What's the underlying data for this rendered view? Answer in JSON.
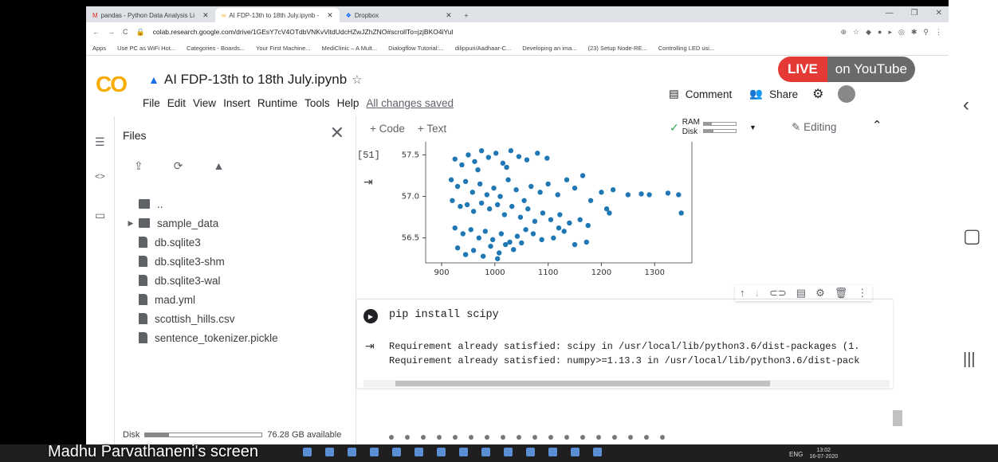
{
  "browser": {
    "tabs": [
      {
        "label": "pandas - Python Data Analysis Li"
      },
      {
        "label": "AI FDP-13th to 18th July.ipynb -"
      },
      {
        "label": "Dropbox"
      }
    ],
    "url": "colab.research.google.com/drive/1GEsY7cV4OTdbVNKvVitdUdcHZwJZhZNO#scrollTo=jzjBKO4iYul",
    "bookmarks": [
      "Apps",
      "Use PC as WiFi Hot...",
      "Categories - Boards...",
      "Your First Machine...",
      "MediClinic – A Mult...",
      "Dialogflow Tutorial:...",
      "dilippuri/Aadhaar-C...",
      "Developing an ima...",
      "(23) Setup Node-RE...",
      "Controlling LED usi..."
    ]
  },
  "colab": {
    "logo": "CO",
    "title": "AI FDP-13th to 18th July.ipynb",
    "menus": [
      "File",
      "Edit",
      "View",
      "Insert",
      "Runtime",
      "Tools",
      "Help"
    ],
    "save_status": "All changes saved",
    "comment_label": "Comment",
    "share_label": "Share"
  },
  "overlay": {
    "live": "LIVE",
    "youtube": "on YouTube",
    "presenter": "Madhu Parvathaneni's screen"
  },
  "files": {
    "title": "Files",
    "items": [
      {
        "name": "..",
        "type": "folder-up"
      },
      {
        "name": "sample_data",
        "type": "folder"
      },
      {
        "name": "db.sqlite3",
        "type": "file"
      },
      {
        "name": "db.sqlite3-shm",
        "type": "file"
      },
      {
        "name": "db.sqlite3-wal",
        "type": "file"
      },
      {
        "name": "mad.yml",
        "type": "file"
      },
      {
        "name": "scottish_hills.csv",
        "type": "file"
      },
      {
        "name": "sentence_tokenizer.pickle",
        "type": "file"
      }
    ],
    "disk_label": "Disk",
    "disk_available": "76.28 GB available",
    "disk_used_fraction": 0.2
  },
  "toolbar": {
    "add_code": "+ Code",
    "add_text": "+ Text",
    "ram_label": "RAM",
    "disk_label": "Disk",
    "ram_fraction": 0.25,
    "disk_fraction": 0.3,
    "editing_label": "Editing"
  },
  "cells": {
    "plot_cell_number": "[51]",
    "code": "pip install scipy",
    "output_lines": [
      "Requirement already satisfied: scipy in /usr/local/lib/python3.6/dist-packages (1.",
      "Requirement already satisfied: numpy>=1.13.3 in /usr/local/lib/python3.6/dist-pack"
    ]
  },
  "taskbar": {
    "lang": "ENG",
    "time": "13:02",
    "date": "16-07-2020"
  },
  "chart_data": {
    "type": "scatter",
    "x_ticks": [
      900,
      1000,
      1100,
      1200,
      1300
    ],
    "y_ticks": [
      56.5,
      57.0,
      57.5
    ],
    "xlim": [
      870,
      1370
    ],
    "ylim": [
      56.2,
      57.6
    ],
    "color": "#1f77b4",
    "points": [
      [
        925,
        57.45
      ],
      [
        938,
        57.38
      ],
      [
        950,
        57.5
      ],
      [
        962,
        57.42
      ],
      [
        975,
        57.55
      ],
      [
        988,
        57.47
      ],
      [
        1002,
        57.52
      ],
      [
        1015,
        57.4
      ],
      [
        1030,
        57.55
      ],
      [
        1045,
        57.48
      ],
      [
        1060,
        57.44
      ],
      [
        1080,
        57.52
      ],
      [
        1098,
        57.46
      ],
      [
        1022,
        57.35
      ],
      [
        968,
        57.32
      ],
      [
        918,
        57.2
      ],
      [
        930,
        57.12
      ],
      [
        945,
        57.18
      ],
      [
        958,
        57.05
      ],
      [
        972,
        57.15
      ],
      [
        985,
        57.02
      ],
      [
        998,
        57.1
      ],
      [
        1010,
        57.0
      ],
      [
        1025,
        57.2
      ],
      [
        1040,
        57.08
      ],
      [
        1055,
        56.95
      ],
      [
        1068,
        57.12
      ],
      [
        1085,
        57.05
      ],
      [
        1100,
        57.15
      ],
      [
        1118,
        57.02
      ],
      [
        1135,
        57.2
      ],
      [
        1150,
        57.1
      ],
      [
        1165,
        57.25
      ],
      [
        1180,
        56.95
      ],
      [
        1200,
        57.05
      ],
      [
        1222,
        57.08
      ],
      [
        1250,
        57.02
      ],
      [
        1275,
        57.03
      ],
      [
        1290,
        57.02
      ],
      [
        1325,
        57.04
      ],
      [
        1345,
        57.02
      ],
      [
        1350,
        56.8
      ],
      [
        920,
        56.95
      ],
      [
        935,
        56.88
      ],
      [
        948,
        56.9
      ],
      [
        960,
        56.82
      ],
      [
        975,
        56.92
      ],
      [
        990,
        56.85
      ],
      [
        1005,
        56.9
      ],
      [
        1018,
        56.78
      ],
      [
        1032,
        56.88
      ],
      [
        1048,
        56.75
      ],
      [
        1062,
        56.85
      ],
      [
        1075,
        56.7
      ],
      [
        1090,
        56.8
      ],
      [
        1105,
        56.72
      ],
      [
        1122,
        56.78
      ],
      [
        1140,
        56.68
      ],
      [
        1160,
        56.72
      ],
      [
        1175,
        56.65
      ],
      [
        1210,
        56.85
      ],
      [
        1215,
        56.8
      ],
      [
        925,
        56.62
      ],
      [
        940,
        56.55
      ],
      [
        955,
        56.6
      ],
      [
        970,
        56.5
      ],
      [
        982,
        56.58
      ],
      [
        996,
        56.48
      ],
      [
        1012,
        56.55
      ],
      [
        1028,
        56.45
      ],
      [
        1042,
        56.52
      ],
      [
        1058,
        56.6
      ],
      [
        1072,
        56.55
      ],
      [
        1088,
        56.48
      ],
      [
        1110,
        56.5
      ],
      [
        1130,
        56.58
      ],
      [
        1150,
        56.42
      ],
      [
        1172,
        56.45
      ],
      [
        1120,
        56.62
      ],
      [
        930,
        56.38
      ],
      [
        945,
        56.3
      ],
      [
        960,
        56.35
      ],
      [
        978,
        56.28
      ],
      [
        992,
        56.4
      ],
      [
        1008,
        56.32
      ],
      [
        1020,
        56.42
      ],
      [
        1035,
        56.36
      ],
      [
        1050,
        56.44
      ],
      [
        1005,
        56.25
      ]
    ]
  }
}
